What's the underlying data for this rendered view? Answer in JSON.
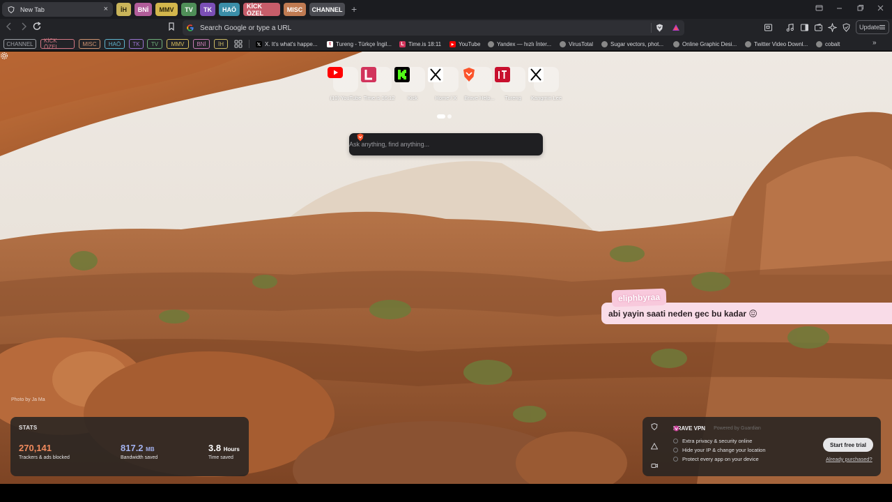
{
  "tabs": {
    "active": {
      "title": "New Tab",
      "close": "×"
    },
    "groups": [
      {
        "label": "İH",
        "bg": "#c9b45a",
        "fg": "#2b2610"
      },
      {
        "label": "BNİ",
        "bg": "#b15d9a",
        "fg": "#ffffff"
      },
      {
        "label": "MMV",
        "bg": "#d3b64c",
        "fg": "#2a230a"
      },
      {
        "label": "TV",
        "bg": "#4f8f58",
        "fg": "#ffffff"
      },
      {
        "label": "TK",
        "bg": "#7b4fb6",
        "fg": "#ffffff"
      },
      {
        "label": "HAÖ",
        "bg": "#3b8ea8",
        "fg": "#ffffff"
      },
      {
        "label": "KİCK ÖZEL",
        "bg": "#c75d6a",
        "fg": "#ffffff"
      },
      {
        "label": "MISC",
        "bg": "#c07b52",
        "fg": "#ffffff"
      },
      {
        "label": "CHANNEL",
        "bg": "#4a4b51",
        "fg": "#ffffff"
      }
    ],
    "new_tab": "+"
  },
  "omnibox": {
    "placeholder": "Search Google or type a URL"
  },
  "update": {
    "label": "Update"
  },
  "bookmarks": {
    "groups": [
      {
        "label": "CHANNEL",
        "color": "#9da0a6"
      },
      {
        "label": "KİCK ÖZEL",
        "color": "#d27784"
      },
      {
        "label": "MISC",
        "color": "#d09572"
      },
      {
        "label": "HAÖ",
        "color": "#5fb5cf"
      },
      {
        "label": "TK",
        "color": "#9a74d1"
      },
      {
        "label": "TV",
        "color": "#6fb07a"
      },
      {
        "label": "MMV",
        "color": "#d9be5c"
      },
      {
        "label": "BNİ",
        "color": "#c87cb3"
      },
      {
        "label": "İH",
        "color": "#cdbb65"
      }
    ],
    "items": [
      {
        "label": "X. It's what's happe...",
        "icon": "x-icon"
      },
      {
        "label": "Tureng - Türkçe İngil...",
        "icon": "tureng-icon"
      },
      {
        "label": "Time.is 18:11",
        "icon": "timeis-icon"
      },
      {
        "label": "YouTube",
        "icon": "youtube-icon"
      },
      {
        "label": "Yandex — hızlı İnter...",
        "icon": "globe-icon"
      },
      {
        "label": "VirusTotal",
        "icon": "globe-icon"
      },
      {
        "label": "Sugar vectors, phot...",
        "icon": "globe-icon"
      },
      {
        "label": "Online Graphic Desi...",
        "icon": "globe-icon"
      },
      {
        "label": "Twitter Video Downl...",
        "icon": "globe-icon"
      },
      {
        "label": "cobalt",
        "icon": "globe-icon"
      }
    ],
    "more": "»"
  },
  "top_sites": [
    {
      "label": "(10) YouTube",
      "icon": "youtube-icon"
    },
    {
      "label": "Time.is 16:12",
      "icon": "timeis-icon"
    },
    {
      "label": "Kick",
      "icon": "kick-icon"
    },
    {
      "label": "Home / X",
      "icon": "x-icon"
    },
    {
      "label": "Brave Help...",
      "icon": "brave-icon"
    },
    {
      "label": "Tureng",
      "icon": "tureng-icon"
    },
    {
      "label": "Kangmin Lee",
      "icon": "x-icon"
    }
  ],
  "search": {
    "placeholder": "Ask anything, find anything..."
  },
  "chat": {
    "username": "eliphbyraa",
    "message": "abi yayin saati neden gec bu kadar 😖"
  },
  "photo_credit": "Photo by Ja Ma",
  "stats": {
    "title": "STATS",
    "trackers": {
      "value": "270,141",
      "caption": "Trackers & ads blocked",
      "color": "#f08a5d"
    },
    "bandwidth": {
      "value": "817.2",
      "unit": "MB",
      "caption": "Bandwidth saved",
      "color": "#a3b2ef"
    },
    "time": {
      "value": "3.8",
      "unit": "Hours",
      "caption": "Time saved",
      "color": "#ffffff"
    }
  },
  "vpn": {
    "title": "BRAVE VPN",
    "powered": "Powered by Guardian",
    "features": [
      "Extra privacy & security online",
      "Hide your IP & change your location",
      "Protect every app on your device"
    ],
    "trial": "Start free trial",
    "already": "Already purchased?"
  }
}
